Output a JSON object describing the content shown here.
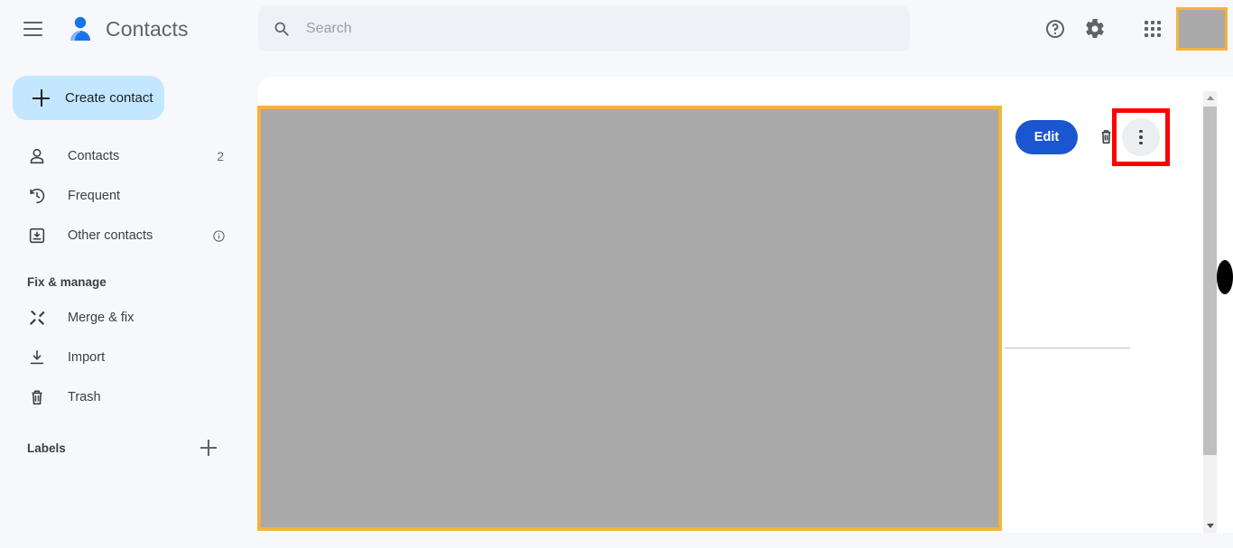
{
  "app": {
    "title": "Contacts",
    "logo_icon": "contacts-person-icon",
    "menu_icon": "hamburger-menu-icon"
  },
  "search": {
    "placeholder": "Search",
    "value": "",
    "icon": "search-icon"
  },
  "top_actions": {
    "help_icon": "help-circle-icon",
    "settings_icon": "gear-icon",
    "apps_icon": "apps-grid-icon",
    "avatar_icon": "account-avatar"
  },
  "sidebar": {
    "create_button": {
      "label": "Create contact",
      "icon": "plus-icon"
    },
    "items": [
      {
        "label": "Contacts",
        "icon": "person-icon",
        "count": "2"
      },
      {
        "label": "Frequent",
        "icon": "history-clock-icon",
        "count": ""
      },
      {
        "label": "Other contacts",
        "icon": "inbox-download-icon",
        "count": "",
        "info_icon": "info-circle-icon"
      }
    ],
    "fix_manage_heading": "Fix & manage",
    "manage_items": [
      {
        "label": "Merge & fix",
        "icon": "merge-tools-icon"
      },
      {
        "label": "Import",
        "icon": "import-download-icon"
      },
      {
        "label": "Trash",
        "icon": "trash-icon"
      }
    ],
    "labels_heading": "Labels",
    "add_label_icon": "plus-icon"
  },
  "main": {
    "photo_placeholder": "",
    "edit_label": "Edit",
    "delete_icon": "trash-icon",
    "more_icon": "more-vertical-icon",
    "highlight_color": "#ff0000",
    "accent_border_color": "#f5b33d"
  },
  "scrollbar": {
    "up_icon": "scroll-up-arrow-icon",
    "down_icon": "scroll-down-arrow-icon"
  },
  "colors": {
    "brand_blue": "#1a73e8",
    "edit_blue": "#1a56d0",
    "create_bg": "#c2e7ff",
    "page_bg": "#f6f8fc",
    "highlight_red": "#ff0000",
    "accent_amber": "#f5b33d"
  }
}
